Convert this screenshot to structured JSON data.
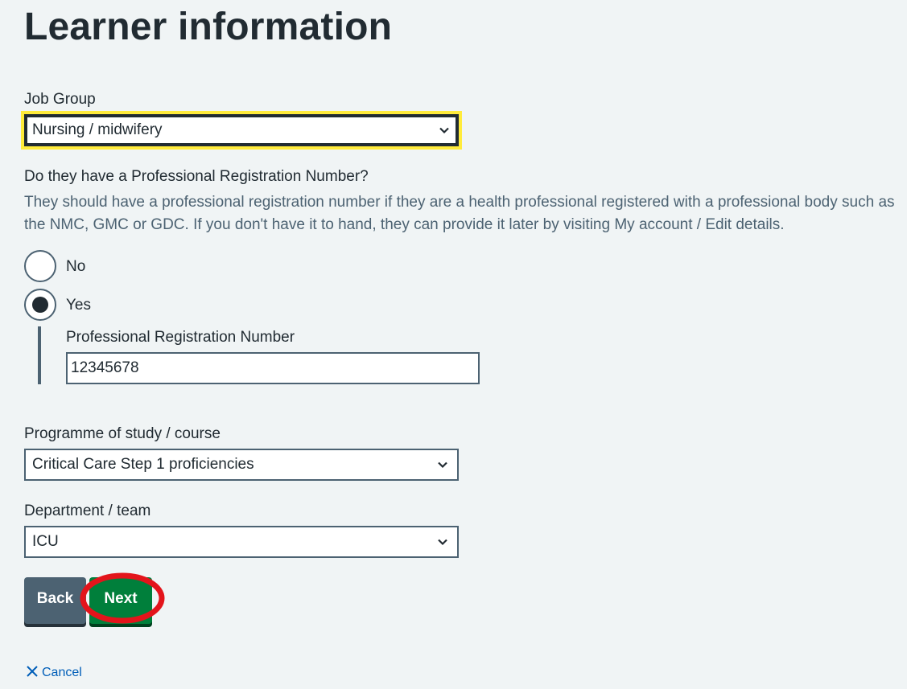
{
  "page": {
    "title": "Learner information"
  },
  "job_group": {
    "label": "Job Group",
    "value": "Nursing / midwifery"
  },
  "registration": {
    "question": "Do they have a Professional Registration Number?",
    "hint": "They should have a professional registration number if they are a health professional registered with a professional body such as the NMC, GMC or GDC. If you don't have it to hand, they can provide it later by visiting My account / Edit details.",
    "options": [
      {
        "label": "No",
        "selected": false
      },
      {
        "label": "Yes",
        "selected": true
      }
    ],
    "number_label": "Professional Registration Number",
    "number_value": "12345678"
  },
  "programme": {
    "label": "Programme of study / course",
    "value": "Critical Care Step 1 proficiencies"
  },
  "department": {
    "label": "Department / team",
    "value": "ICU"
  },
  "actions": {
    "back_label": "Back",
    "next_label": "Next",
    "cancel_label": "Cancel"
  },
  "colors": {
    "background": "#f0f4f5",
    "text": "#212b32",
    "secondary_text": "#4c6272",
    "focus_yellow": "#ffeb3b",
    "primary_button": "#007f3b",
    "secondary_button": "#4c6272",
    "link": "#005eb8",
    "annotation_ring": "#e3141b"
  },
  "icons": {
    "select_chevron": "chevron-down-icon",
    "cancel": "close-icon"
  }
}
